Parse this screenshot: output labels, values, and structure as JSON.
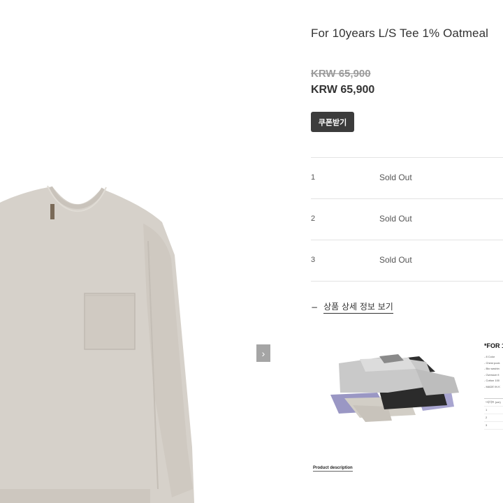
{
  "product": {
    "title": "For 10years L/S Tee 1% Oatmeal",
    "original_price": "KRW 65,900",
    "sale_price": "KRW 65,900",
    "coupon_button": "쿠폰받기"
  },
  "gallery": {
    "next_icon": "›"
  },
  "options": [
    {
      "number": "1",
      "status": "Sold Out"
    },
    {
      "number": "2",
      "status": "Sold Out"
    },
    {
      "number": "3",
      "status": "Sold Out"
    }
  ],
  "detail": {
    "toggle_icon": "−",
    "toggle_label": "상품 상세 정보 보기",
    "image_title": "*FOR 1",
    "spec_lines": [
      "- 8 Color",
      "- Chest pock",
      "- Bio washin",
      "- Oversize fi",
      "- Cotton 100",
      "- MADE IN K"
    ],
    "table_header": "*사이즈 (cm)",
    "table_rows": [
      "1",
      "2",
      "3"
    ],
    "description_label": "Product description"
  },
  "colors": {
    "shirt": "#d6d1ca",
    "coupon_bg": "#3c3c3c",
    "arrow_bg": "#a5a5a5",
    "divider": "#e3e3e3"
  }
}
